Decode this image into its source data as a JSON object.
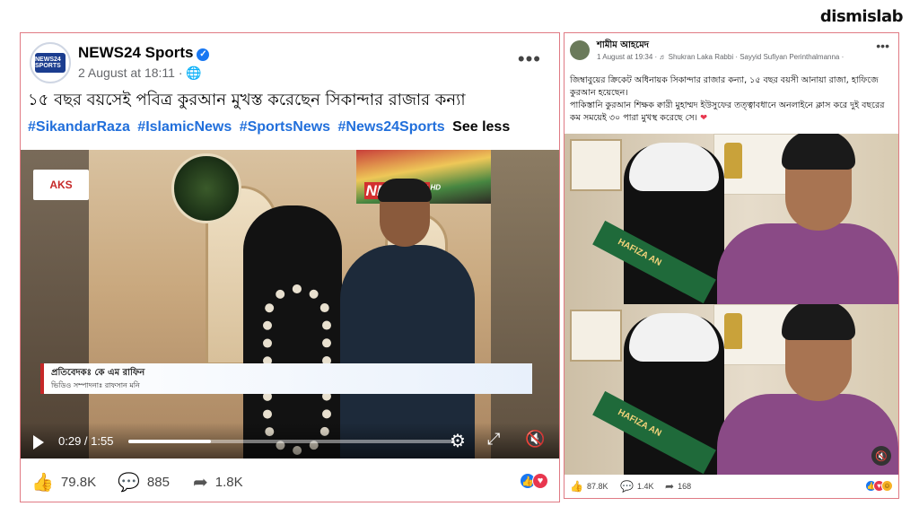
{
  "brand": "dismislab",
  "left_post": {
    "page_name": "NEWS24 Sports",
    "avatar_text": "NEWS24 SPORTS",
    "time": "2 August at 18:11 ·",
    "globe_icon": "🌐",
    "more_icon": "•••",
    "text": "১৫ বছর বয়সেই পবিত্র কুরআন মুখস্ত করেছেন সিকান্দার রাজার কন্যা",
    "hashtags": [
      "#SikandarRaza",
      "#IslamicNews",
      "#SportsNews",
      "#News24Sports"
    ],
    "see_less": "See less",
    "video": {
      "aks_logo": "AKS",
      "channel_logo": "NEWS24",
      "channel_hd": "HD",
      "reporter_line": "প্রতিবেদকঃ কে এম রাফিন",
      "editor_line": "ভিডিও সম্পাদনাঃ রাফসান মনি",
      "time": "0:29 / 1:55",
      "progress": 0.252
    },
    "likes": "79.8K",
    "comments": "885",
    "shares": "1.8K"
  },
  "right_post": {
    "author": "শামীম আহমেদ",
    "meta": "1 August at 19:34 · ♬ Shukran Laka Rabbi · Sayyid Sufiyan Perinthalmanna ·",
    "more_icon": "•••",
    "text_line1": "জিম্বাবুয়ের ক্রিকেট অধিনায়ক সিকান্দার রাজার কন্যা, ১৫ বছর বয়সী আনায়া রাজা, হাফিজে কুরআন হয়েছেন।",
    "text_line2": "পাকিস্তানি কুরআন শিক্ষক ক্বারী মুহাম্মদ ইউসুফের তত্ত্বাবধানে অনলাইনে ক্লাস করে দুই বছরের কম সময়েই ৩০ পারা মুখস্থ করেছে সে।",
    "heart": "❤",
    "sash_text": "HAFIZA AN",
    "likes": "87.8K",
    "comments": "1.4K",
    "shares": "168"
  }
}
